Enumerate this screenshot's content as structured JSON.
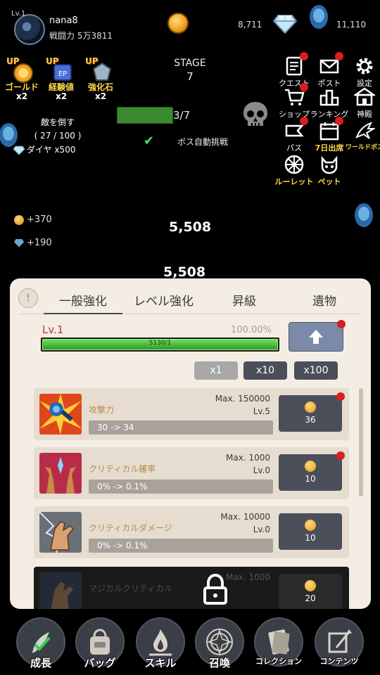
{
  "player": {
    "level": "Lv.1",
    "name": "nana8",
    "power": "戦闘力 5万3811"
  },
  "currency": {
    "gold": "8,711",
    "diamonds": "11,110"
  },
  "boosts": [
    {
      "badge": "UP",
      "label": "ゴールド",
      "mult": "x2"
    },
    {
      "badge": "UP",
      "label": "経験値",
      "mult": "x2"
    },
    {
      "badge": "UP",
      "label": "強化石",
      "mult": "x2"
    }
  ],
  "stage": {
    "label": "STAGE",
    "number": "7",
    "progress_text": "3/7",
    "auto_boss_label": "ボス自動挑戦"
  },
  "quest": {
    "defeat_label": "敵を倒す",
    "count": "( 27 / 100 )",
    "reward": "ダイヤ x500"
  },
  "menu": [
    {
      "label": "クエスト",
      "icon": "quest-icon",
      "badge": true
    },
    {
      "label": "ポスト",
      "icon": "mail-icon",
      "badge": true
    },
    {
      "label": "設定",
      "icon": "gear-icon",
      "badge": false
    },
    {
      "label": "ショップ",
      "icon": "cart-icon",
      "badge": true
    },
    {
      "label": "ランキング",
      "icon": "ranking-icon",
      "badge": false
    },
    {
      "label": "神殿",
      "icon": "temple-icon",
      "badge": false
    },
    {
      "label": "パス",
      "icon": "pass-icon",
      "badge": true
    },
    {
      "label": "7日出席",
      "icon": "calendar-icon",
      "badge": true
    },
    {
      "label": "ワールドボス",
      "icon": "dragon-icon",
      "badge": false
    },
    {
      "label": "ルーレット",
      "icon": "roulette-icon",
      "badge": false
    },
    {
      "label": "ペット",
      "icon": "pet-icon",
      "badge": false
    }
  ],
  "gains": {
    "gold": "+370",
    "gems": "+190"
  },
  "damage": [
    "5,508",
    "5,508"
  ],
  "panel": {
    "info_icon": "!",
    "tabs": [
      "一般強化",
      "レベル強化",
      "昇級",
      "遺物"
    ],
    "level": "Lv.1",
    "percent": "100.00%",
    "exp_value": "5130/1",
    "exp_fraction": 1.0,
    "multipliers": [
      "x1",
      "x10",
      "x100"
    ],
    "items": [
      {
        "name": "攻撃力",
        "max": "Max. 150000",
        "lv": "Lv.5",
        "progress": "30 -> 34",
        "cost": "36",
        "locked": false
      },
      {
        "name": "クリティカル確率",
        "max": "Max. 1000",
        "lv": "Lv.0",
        "progress": "0% -> 0.1%",
        "cost": "10",
        "locked": false
      },
      {
        "name": "クリティカルダメージ",
        "max": "Max. 10000",
        "lv": "Lv.0",
        "progress": "0% -> 0.1%",
        "cost": "10",
        "locked": false
      },
      {
        "name": "マジカルクリティカル",
        "max": "Max. 1000",
        "lv": "",
        "progress": "",
        "cost": "20",
        "locked": true
      }
    ]
  },
  "nav": [
    {
      "label": "成長",
      "icon": "growth-icon"
    },
    {
      "label": "バッグ",
      "icon": "bag-icon"
    },
    {
      "label": "スキル",
      "icon": "skill-icon"
    },
    {
      "label": "召喚",
      "icon": "summon-icon"
    },
    {
      "label": "コレクション",
      "icon": "collection-icon"
    },
    {
      "label": "コンテンツ",
      "icon": "contents-icon"
    }
  ],
  "colors": {
    "panel_bg": "#f3ede4",
    "accent_red": "#c0392b",
    "badge_red": "#d81e1e",
    "exp_green": "#2f9a28",
    "button_dark": "#4a4f5a"
  }
}
